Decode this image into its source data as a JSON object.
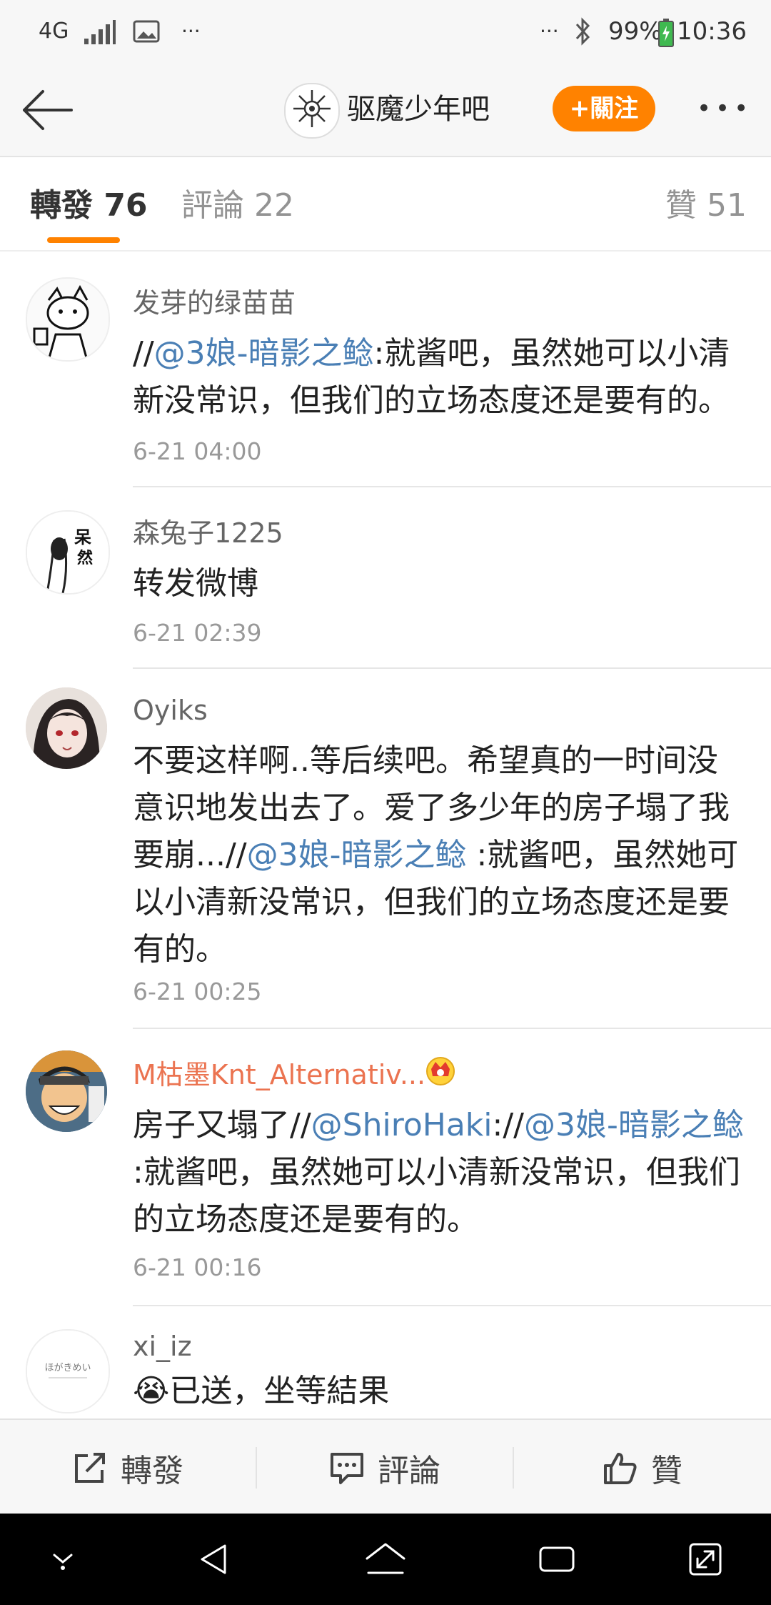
{
  "status_bar": {
    "network": "4G",
    "more": "···",
    "more_right": "···",
    "battery": "99%",
    "time": "10:36"
  },
  "header": {
    "group_name": "驱魔少年吧",
    "follow_label": "+關注",
    "more_label": "•••"
  },
  "tabs": {
    "forward": "轉發 76",
    "comment": "評論 22",
    "like": "贊 51"
  },
  "feed": [
    {
      "user": "发芽的绿苗苗",
      "parts": [
        {
          "t": "//",
          "link": false
        },
        {
          "t": "@3娘-暗影之鲶",
          "link": true
        },
        {
          "t": ":就酱吧，虽然她可以小清新没常识，但我们的立场态度还是要有的。",
          "link": false
        }
      ],
      "time": "6-21 04:00"
    },
    {
      "user": "森兔子1225",
      "parts": [
        {
          "t": "转发微博",
          "link": false
        }
      ],
      "time": "6-21 02:39"
    },
    {
      "user": "Oyiks",
      "parts": [
        {
          "t": "不要这样啊..等后续吧。希望真的一时间没意识地发出去了。爱了多少年的房子塌了我要崩...//",
          "link": false
        },
        {
          "t": "@3娘-暗影之鲶",
          "link": true
        },
        {
          "t": " :就酱吧，虽然她可以小清新没常识，但我们的立场态度还是要有的。",
          "link": false
        }
      ],
      "time": "6-21 00:25"
    },
    {
      "user": "M枯墨Knt_Alternativ...",
      "user_color": "#eb7350",
      "parts": [
        {
          "t": "房子又塌了//",
          "link": false
        },
        {
          "t": "@ShiroHaki",
          "link": true
        },
        {
          "t": "://",
          "link": false
        },
        {
          "t": "@3娘-暗影之鲶",
          "link": true
        },
        {
          "t": " :就酱吧，虽然她可以小清新没常识，但我们的立场态度还是要有的。",
          "link": false
        }
      ],
      "time": "6-21 00:16"
    },
    {
      "user": "xi_iz",
      "parts": [
        {
          "t": "😭已送，坐等結果",
          "link": false
        }
      ],
      "time": ""
    }
  ],
  "bottom_bar": {
    "forward": "轉發",
    "comment": "評論",
    "like": "贊"
  },
  "colors": {
    "accent": "#ff8200",
    "link": "#4a7fb5",
    "vip_name": "#eb7350"
  }
}
